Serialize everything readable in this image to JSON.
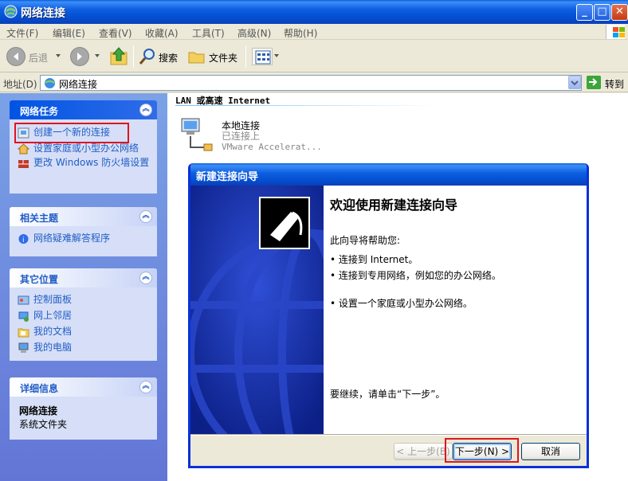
{
  "window": {
    "title": "网络连接"
  },
  "menu": [
    "文件(F)",
    "编辑(E)",
    "查看(V)",
    "收藏(A)",
    "工具(T)",
    "高级(N)",
    "帮助(H)"
  ],
  "toolbar": {
    "back": "后退",
    "search": "搜索",
    "folders": "文件夹"
  },
  "address": {
    "label": "地址(D)",
    "value": "网络连接",
    "go": "转到"
  },
  "tasks": {
    "network_tasks": {
      "title": "网络任务",
      "items": [
        "创建一个新的连接",
        "设置家庭或小型办公网络",
        "更改 Windows 防火墙设置"
      ]
    },
    "related": {
      "title": "相关主题",
      "items": [
        "网络疑难解答程序"
      ]
    },
    "other_places": {
      "title": "其它位置",
      "items": [
        "控制面板",
        "网上邻居",
        "我的文档",
        "我的电脑"
      ]
    },
    "details": {
      "title": "详细信息",
      "name": "网络连接",
      "type": "系统文件夹"
    }
  },
  "content": {
    "group_header": "LAN 或高速 Internet",
    "connection": {
      "name": "本地连接",
      "status": "已连接上",
      "device": "VMware Accelerat..."
    }
  },
  "wizard": {
    "title": "新建连接向导",
    "heading": "欢迎使用新建连接向导",
    "intro": "此向导将帮助您:",
    "bullets": [
      "连接到 Internet。",
      "连接到专用网络，例如您的办公网络。",
      "设置一个家庭或小型办公网络。"
    ],
    "continue": "要继续，请单击“下一步”。",
    "buttons": {
      "back": "< 上一步(B)",
      "next": "下一步(N) >",
      "cancel": "取消"
    }
  },
  "colors": {
    "highlight": "#e0141e",
    "xp_blue": "#0054e3",
    "task_link": "#215dc6"
  }
}
